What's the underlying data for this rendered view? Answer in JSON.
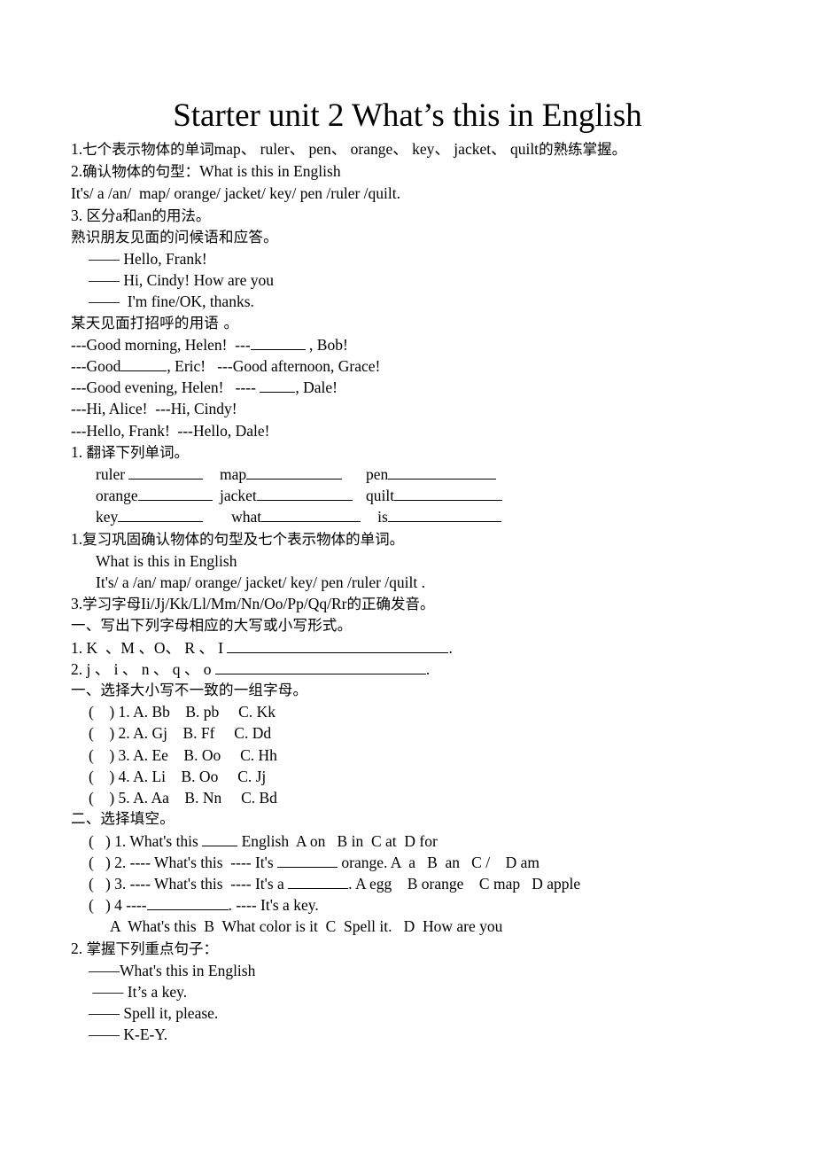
{
  "document": {
    "title": "Starter unit 2 What’s this in English",
    "sections": {
      "objectives": {
        "line1_pre": "1.",
        "line1_cn_a": "七个表示物体的单词",
        "line1_words": "map、 ruler、 pen、 orange、 key、 jacket、 quilt",
        "line1_cn_b": "的熟练掌握。",
        "line2_pre": "2.",
        "line2_cn": "确认物体的句型：",
        "line2_en": "What is this in English",
        "line3": "It's/ a /an/  map/ orange/ jacket/ key/ pen /ruler /quilt.",
        "line4_pre": "3. ",
        "line4_cn_a": "区分",
        "line4_en_a": "a",
        "line4_cn_b": "和",
        "line4_en_b": "an",
        "line4_cn_c": "的用法。",
        "line5_cn": "熟识朋友见面的问候语和应答。"
      },
      "greetings_basic": {
        "l1": "—— Hello, Frank!",
        "l2": "—— Hi, Cindy! How are you",
        "l3": "——  I'm fine/OK, thanks."
      },
      "daily_greetings": {
        "heading_cn": "某天见面打招呼的用语 。",
        "g1_a": "---Good morning, Helen!  ---",
        "g1_b": " , Bob!",
        "g2_a": "---Good",
        "g2_b": ", Eric!   ---Good afternoon, Grace!",
        "g3_a": "---Good evening, Helen!   ---- ",
        "g3_b": ", Dale!",
        "g4": "---Hi, Alice!  ---Hi, Cindy!",
        "g5": "---Hello, Frank!  ---Hello, Dale!"
      },
      "translate": {
        "heading_pre": "1. ",
        "heading_cn": "翻译下列单词。",
        "rows": [
          [
            "ruler ",
            "map",
            "pen"
          ],
          [
            "orange",
            "jacket",
            "quilt"
          ],
          [
            "key",
            "   what",
            "   is"
          ]
        ]
      },
      "review": {
        "line1_pre": "1.",
        "line1_cn": "复习巩固确认物体的句型及七个表示物体的单词。",
        "line2": "What is this in English",
        "line3": "It's/ a /an/ map/ orange/ jacket/ key/ pen /ruler /quilt .",
        "line4_pre": "3.",
        "line4_cn_a": "学习字母",
        "line4_en": "Ii/Jj/Kk/Ll/Mm/Nn/Oo/Pp/Qq/Rr",
        "line4_cn_b": "的正确发音。"
      },
      "letter_forms": {
        "heading_cn": "一、写出下列字母相应的大写或小写形式。",
        "q1": "1. K  、M 、O、 R 、 I ",
        "q1_end": ".",
        "q2": "2. j 、 i 、 n 、 q 、 o ",
        "q2_end": "."
      },
      "choose_mismatch": {
        "heading_cn": "一、选择大小写不一致的一组字母。",
        "items": [
          "(    ) 1. A. Bb    B. pb     C. Kk",
          "(    ) 2. A. Gj    B. Ff     C. Dd",
          "(    ) 3. A. Ee    B. Oo     C. Hh",
          "(    ) 4. A. Li    B. Oo     C. Jj",
          "(    ) 5. A. Aa    B. Nn     C. Bd"
        ]
      },
      "fill_choice": {
        "heading_cn": "二、选择填空。",
        "q1_a": "(   ) 1. What's this ",
        "q1_b": " English  A on   B in  C at  D for",
        "q2_a": "(   ) 2. ---- What's this  ---- It's ",
        "q2_b": " orange. A  a   B  an   C /    D am",
        "q3_a": "(   ) 3. ---- What's this  ---- It's a ",
        "q3_b": ". A egg    B orange    C map   D apple",
        "q4_a": "(   ) 4 ----",
        "q4_b": ". ---- It's a key.",
        "q4_options": "A  What's this  B  What color is it  C  Spell it.   D  How are you"
      },
      "key_sentences": {
        "heading_pre": "2. ",
        "heading_cn": "掌握下列重点句子：",
        "l1": "——What's this in English",
        "l2": " —— It’s a key.",
        "l3": "—— Spell it, please.",
        "l4": "—— K-E-Y."
      }
    }
  }
}
